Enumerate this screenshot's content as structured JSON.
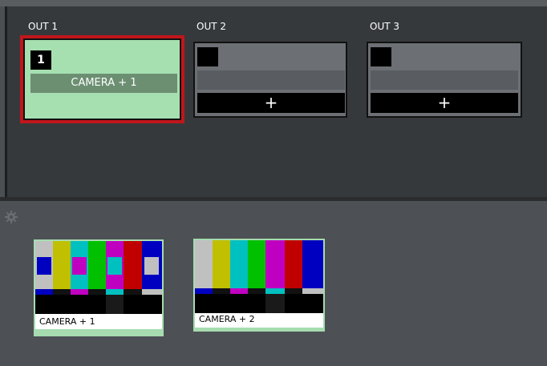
{
  "outputs": [
    {
      "label": "OUT 1",
      "badge": "1",
      "source": "CAMERA + 1",
      "active": true
    },
    {
      "label": "OUT 2",
      "badge": "",
      "add_label": "+"
    },
    {
      "label": "OUT 3",
      "badge": "",
      "add_label": "+"
    }
  ],
  "sources": [
    {
      "caption": "CAMERA + 1"
    },
    {
      "caption": "CAMERA + 2"
    }
  ],
  "colors": {
    "active_border": "#c0161b",
    "active_fill": "#a6e0b0",
    "panel": "#36393c",
    "background": "#4b4f53"
  },
  "icons": [
    "gear-icon",
    "plus-icon"
  ]
}
